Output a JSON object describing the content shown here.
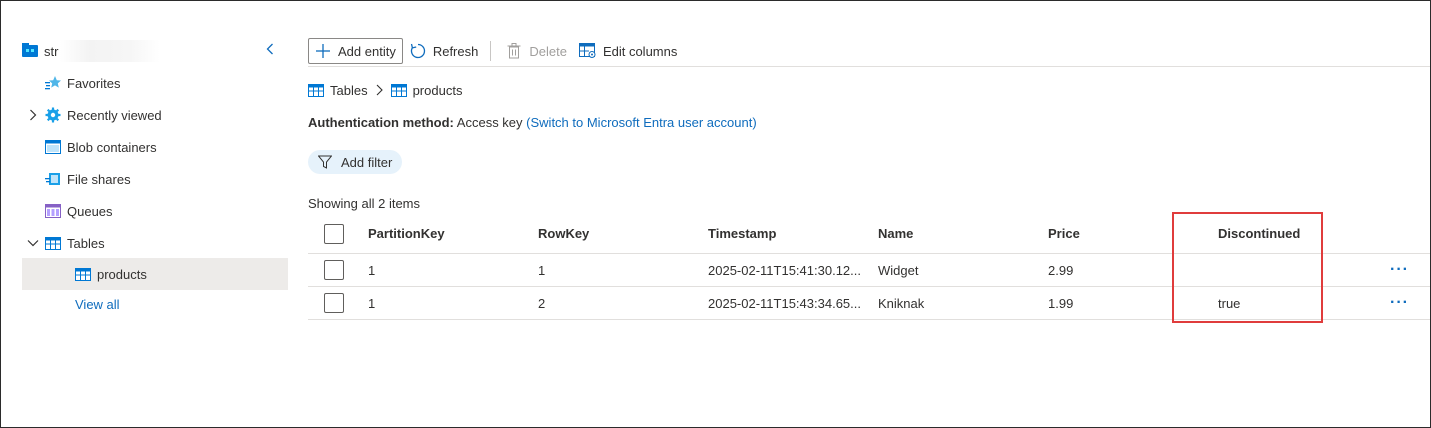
{
  "sidebar": {
    "account_name": "str",
    "items": [
      {
        "label": "Favorites",
        "icon": "star-icon"
      },
      {
        "label": "Recently viewed",
        "icon": "gear-icon"
      },
      {
        "label": "Blob containers",
        "icon": "blob-container-icon"
      },
      {
        "label": "File shares",
        "icon": "file-share-icon"
      },
      {
        "label": "Queues",
        "icon": "queue-icon"
      },
      {
        "label": "Tables",
        "icon": "table-icon"
      },
      {
        "label": "products",
        "icon": "table-icon"
      }
    ],
    "view_all": "View all"
  },
  "toolbar": {
    "add_entity": "Add entity",
    "refresh": "Refresh",
    "delete": "Delete",
    "edit_columns": "Edit columns"
  },
  "breadcrumb": {
    "root": "Tables",
    "current": "products"
  },
  "auth": {
    "label": "Authentication method:",
    "value": "Access key",
    "switch_link": "(Switch to Microsoft Entra user account)"
  },
  "filter": {
    "label": "Add filter"
  },
  "status": {
    "showing": "Showing all 2 items"
  },
  "table": {
    "columns": [
      "PartitionKey",
      "RowKey",
      "Timestamp",
      "Name",
      "Price",
      "Discontinued"
    ],
    "rows": [
      [
        "1",
        "1",
        "2025-02-11T15:41:30.12...",
        "Widget",
        "2.99",
        ""
      ],
      [
        "1",
        "2",
        "2025-02-11T15:43:34.65...",
        "Kniknak",
        "1.99",
        "true"
      ]
    ],
    "more_label": "···"
  },
  "colors": {
    "accent": "#0f6cbd",
    "highlight": "#e03c3c",
    "selected_bg": "#edebe9",
    "filter_bg": "#e6f2fb"
  }
}
